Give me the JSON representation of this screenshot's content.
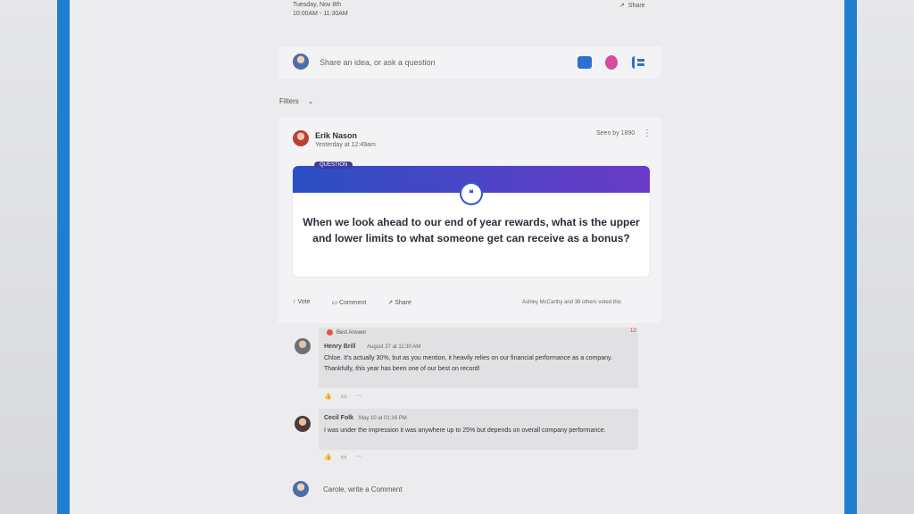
{
  "event": {
    "date": "Tuesday, Nov 8th",
    "time": "10:00AM - 11:30AM",
    "share_label": "Share"
  },
  "composer": {
    "placeholder": "Share an idea, or ask a question",
    "icons": [
      "question-icon",
      "praise-icon",
      "poll-icon"
    ],
    "accent": "#2f6fd2"
  },
  "filters": {
    "label": "Filters"
  },
  "post": {
    "author": "Erik Nason",
    "time": "Yesterday at 12:49am",
    "seen": "Seen by 1890",
    "badge": "QUESTION",
    "question": "When we look ahead to our end of year rewards, what is the upper and lower limits to what someone get can receive as a bonus?",
    "actions": {
      "vote": "Vote",
      "comment": "Comment",
      "share": "Share"
    },
    "voted_by": "Ashley McCarthy and 38 others voted this",
    "band_colors": [
      "#2a4fc4",
      "#6a3ac7"
    ]
  },
  "replies": [
    {
      "best_answer": "Best Answer",
      "badge": "12",
      "name": "Henry Brill",
      "time": "August 27 at 11:30 AM",
      "text": "Chloe. It's actually 30%, but as you mention, it heavily relies on our financial performance as a company. Thankfully, this year has been one of our best on record!"
    },
    {
      "name": "Cecil Folk",
      "time": "May 10 at 01:16 PM",
      "text": "I was under the impression it was anywhere up to 25% but depends on overall company performance."
    }
  ],
  "comment_prompt": "Carole, write a Comment"
}
